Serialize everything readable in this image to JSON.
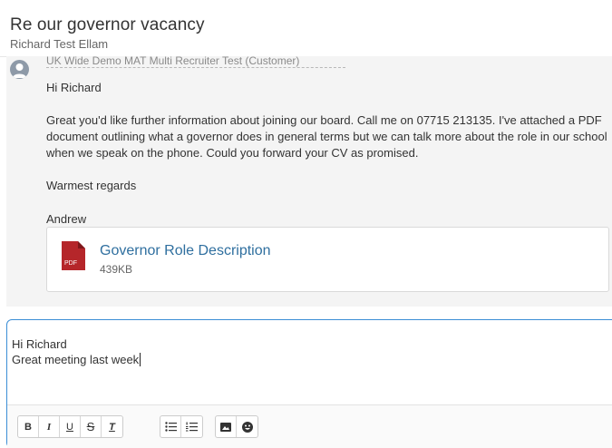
{
  "header": {
    "title": "Re our governor vacancy",
    "subtitle": "Richard Test Ellam"
  },
  "message": {
    "sender_line": "UK Wide Demo MAT Multi Recruiter Test (Customer)",
    "greeting": "Hi Richard",
    "body": "Great you'd like further information about joining our board. Call me on 07715 213135. I've attached a PDF document outlining what a governor does in general terms but we can talk more about the role in our school when we speak on the phone. Could you forward your CV as promised.",
    "signoff": "Warmest regards",
    "name": "Andrew",
    "attachment": {
      "name": "Governor Role Description",
      "size": "439KB",
      "type_label": "PDF"
    }
  },
  "compose": {
    "line1": "Hi Richard",
    "line2": "Great meeting last week"
  },
  "toolbar": {
    "bold_label": "B",
    "italic_label": "I",
    "underline_label": "U",
    "strike_label": "S",
    "clear_label": "T"
  },
  "colors": {
    "link": "#2f6f9f",
    "pdf_red": "#b5262a",
    "focus_border": "#3b8ed6"
  }
}
